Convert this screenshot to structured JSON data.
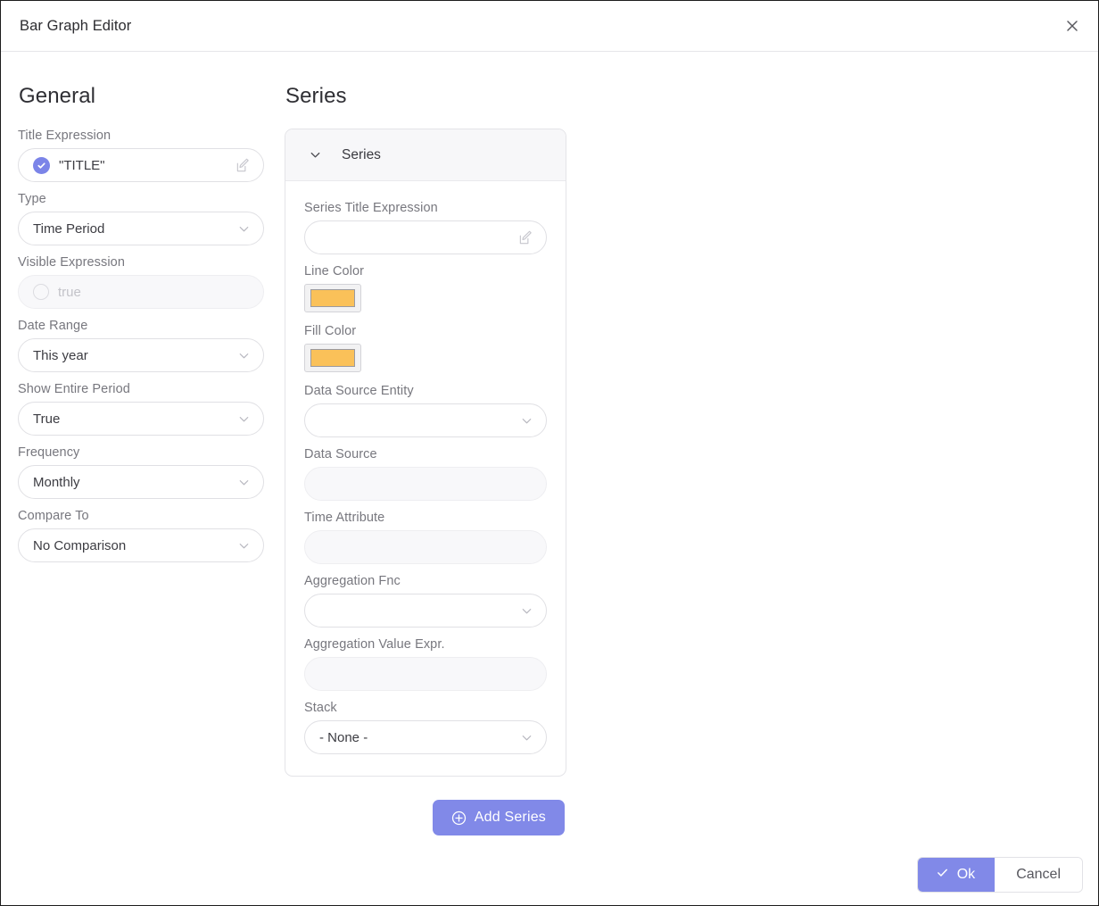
{
  "window": {
    "title": "Bar Graph Editor",
    "close_icon": "close-icon"
  },
  "theme": {
    "accent": "#8189e8",
    "series_color": "#fac159",
    "label_color": "#77777e",
    "value_color": "#3c3c42"
  },
  "general": {
    "heading": "General",
    "fields": [
      {
        "label": "Title Expression",
        "value": "\"TITLE\"",
        "type": "expression",
        "status": "valid",
        "disabled": false,
        "edit_icon": "edit-pencil-icon"
      },
      {
        "label": "Type",
        "value": "Time Period",
        "type": "select",
        "disabled": false
      },
      {
        "label": "Visible Expression",
        "value": "true",
        "type": "expression",
        "status": "empty",
        "disabled": true
      },
      {
        "label": "Date Range",
        "value": "This year",
        "type": "select",
        "disabled": false
      },
      {
        "label": "Show Entire Period",
        "value": "True",
        "type": "select",
        "disabled": false
      },
      {
        "label": "Frequency",
        "value": "Monthly",
        "type": "select",
        "disabled": false
      },
      {
        "label": "Compare To",
        "value": "No Comparison",
        "type": "select",
        "disabled": false
      }
    ]
  },
  "series": {
    "heading": "Series",
    "panel": {
      "title": "Series",
      "collapse_icon": "chevron-down-icon",
      "expanded": true,
      "fields": [
        {
          "label": "Series Title Expression",
          "value": "",
          "type": "expression",
          "status": "none",
          "disabled": false,
          "edit_icon": "edit-pencil-icon"
        },
        {
          "label": "Line Color",
          "value": "#fac159",
          "type": "color"
        },
        {
          "label": "Fill Color",
          "value": "#fac159",
          "type": "color"
        },
        {
          "label": "Data Source Entity",
          "value": "",
          "type": "select",
          "disabled": false
        },
        {
          "label": "Data Source",
          "value": "",
          "type": "text",
          "disabled": true
        },
        {
          "label": "Time Attribute",
          "value": "",
          "type": "text",
          "disabled": true
        },
        {
          "label": "Aggregation Fnc",
          "value": "",
          "type": "select",
          "disabled": false
        },
        {
          "label": "Aggregation Value Expr.",
          "value": "",
          "type": "text",
          "disabled": true
        },
        {
          "label": "Stack",
          "value": "- None -",
          "type": "select",
          "disabled": false
        }
      ]
    },
    "add_button": {
      "label": "Add Series",
      "icon": "plus-circle-icon"
    }
  },
  "footer": {
    "ok_label": "Ok",
    "ok_icon": "check-icon",
    "cancel_label": "Cancel"
  }
}
